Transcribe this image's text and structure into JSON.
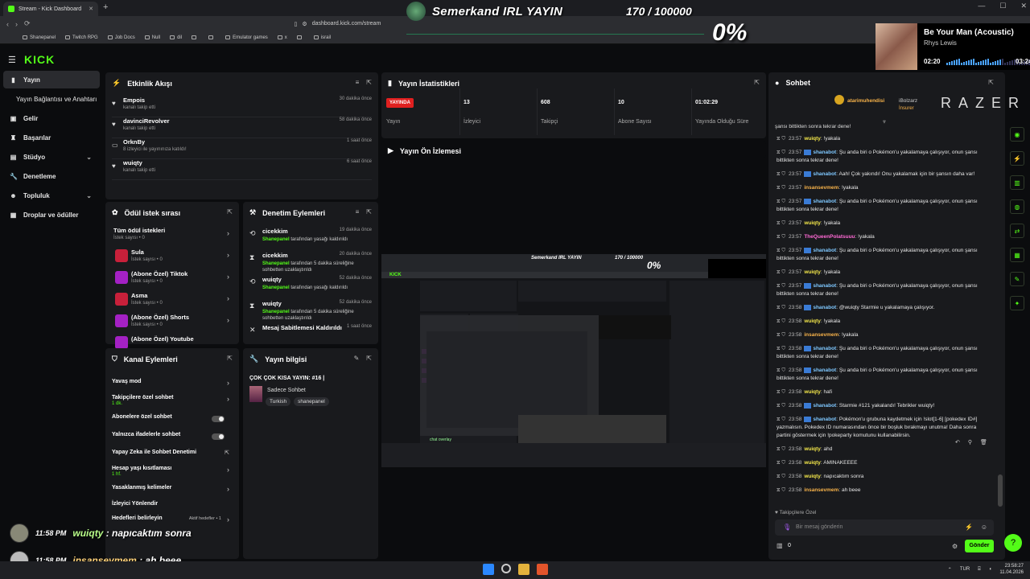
{
  "browser": {
    "tab_title": "Stream - Kick Dashboard",
    "url": "dashboard.kick.com/stream",
    "bookmarks": [
      "Shanepanel",
      "Twitch RPG",
      "Job Docs",
      "Null",
      "dil",
      "",
      "",
      "Emulator games",
      "x",
      "",
      "israil"
    ]
  },
  "overlay": {
    "stream_title": "Semerkand IRL YAYIN",
    "follower_goal": "170 / 100000",
    "percent": "0%",
    "music": {
      "song": "Be Your Man (Acoustic)",
      "artist": "Rhys Lewis",
      "elapsed": "02:20",
      "duration": "03:24"
    }
  },
  "sidebar": {
    "logo": "KICK",
    "items": [
      {
        "label": "Yayın",
        "icon": "broadcast-icon"
      },
      {
        "label": "Yayın Bağlantısı ve Anahtarı",
        "icon": ""
      },
      {
        "label": "Gelir",
        "icon": "revenue-icon"
      },
      {
        "label": "Başarılar",
        "icon": "trophy-icon"
      },
      {
        "label": "Stüdyo",
        "icon": "studio-icon"
      },
      {
        "label": "Denetleme",
        "icon": "wrench-icon"
      },
      {
        "label": "Topluluk",
        "icon": "community-icon"
      },
      {
        "label": "Droplar ve ödüller",
        "icon": "gift-icon"
      }
    ]
  },
  "activity": {
    "title": "Etkinlik Akışı",
    "items": [
      {
        "name": "Empois",
        "desc": "kanalı takip etti",
        "time": "30 dakika önce"
      },
      {
        "name": "davinciRevolver",
        "desc": "kanalı takip etti",
        "time": "58 dakika önce"
      },
      {
        "name": "OrknBy",
        "desc": "8 izleyici ile yayınınıza katıldı!",
        "time": "1 saat önce"
      },
      {
        "name": "wuiqty",
        "desc": "kanalı takip etti",
        "time": "6 saat önce"
      }
    ]
  },
  "stats": {
    "title": "Yayın İstatistikleri",
    "live_badge": "YAYINDA",
    "status_label": "Yayın",
    "viewers": "13",
    "viewers_label": "İzleyici",
    "followers": "608",
    "followers_label": "Takipçi",
    "subs": "10",
    "subs_label": "Abone Sayısı",
    "uptime": "01:02:29",
    "uptime_label": "Yayında Olduğu Süre"
  },
  "preview": {
    "title": "Yayın Ön İzlemesi"
  },
  "rewards": {
    "title": "Ödül istek sırası",
    "items": [
      {
        "name": "Tüm ödül istekleri",
        "sub": "İstek sayısı • 0"
      },
      {
        "name": "Sula",
        "sub": "İstek sayısı • 0"
      },
      {
        "name": "(Abone Özel) Tiktok",
        "sub": "İstek sayısı • 0"
      },
      {
        "name": "Asma",
        "sub": "İstek sayısı • 0"
      },
      {
        "name": "(Abone Özel) Shorts",
        "sub": "İstek sayısı • 0"
      },
      {
        "name": "(Abone Özel) Youtube",
        "sub": ""
      }
    ]
  },
  "moderation": {
    "title": "Denetim Eylemleri",
    "items": [
      {
        "name": "cicekkim",
        "by": "Shanepanel",
        "desc": "tarafından yasağı kaldırıldı",
        "time": "19 dakika önce"
      },
      {
        "name": "cicekkim",
        "by": "Shanepanel",
        "desc": "tarafından 5 dakika süreliğine sohbetten uzaklaştırıldı",
        "time": "20 dakika önce"
      },
      {
        "name": "wuiqty",
        "by": "Shanepanel",
        "desc": "tarafından yasağı kaldırıldı",
        "time": "52 dakika önce"
      },
      {
        "name": "wuiqty",
        "by": "Shanepanel",
        "desc": "tarafından 5 dakika süreliğine sohbetten uzaklaştırıldı",
        "time": "52 dakika önce"
      },
      {
        "name": "Mesaj Sabitlemesi Kaldırıldı",
        "by": "",
        "desc": "",
        "time": "1 saat önce"
      }
    ]
  },
  "channel_actions": {
    "title": "Kanal Eylemleri",
    "items": [
      {
        "label": "Yavaş mod",
        "sub": ""
      },
      {
        "label": "Takipçilere özel sohbet",
        "sub": "1 dk."
      },
      {
        "label": "Abonelere özel sohbet",
        "sub": ""
      },
      {
        "label": "Yalnızca ifadelerle sohbet",
        "sub": ""
      },
      {
        "label": "Yapay Zeka ile Sohbet Denetimi",
        "sub": ""
      },
      {
        "label": "Hesap yaşı kısıtlaması",
        "sub": "1 hf."
      },
      {
        "label": "Yasaklanmış kelimeler",
        "sub": ""
      },
      {
        "label": "İzleyici Yönlendir",
        "sub": ""
      },
      {
        "label": "Hedefleri belirleyin",
        "sub": "Aktif hedefler • 1"
      }
    ]
  },
  "stream_info": {
    "title": "Yayın bilgisi",
    "stream_title": "ÇOK ÇOK KISA YAYIN: #16 |",
    "category": "Sadece Sohbet",
    "tags": [
      "Turkish",
      "shanepanel"
    ]
  },
  "chat": {
    "title": "Sohbet",
    "pinned_user": "atarimuhendisi",
    "pinned_user2": "iBolzarz",
    "pinned_tag": "İnsurer",
    "sponsor": "RAZER",
    "cut_top": "şansı bittikten sonra tekrar dene!",
    "messages": [
      {
        "time": "23:57",
        "user": "wuiqty",
        "cls": "u-w",
        "bot": false,
        "text": "!yakala"
      },
      {
        "time": "23:57",
        "user": "shanabot",
        "cls": "u-s",
        "bot": true,
        "text": "Şu anda biri o Pokémon'u yakalamaya çalışıyor, onun şansı bittikten sonra tekrar dene!"
      },
      {
        "time": "23:57",
        "user": "shanabot",
        "cls": "u-s",
        "bot": true,
        "text": "Aah! Çok yakındı! Onu yakalamak için bir şansın daha var!"
      },
      {
        "time": "23:57",
        "user": "insansevmem",
        "cls": "u-i",
        "bot": false,
        "text": "!yakala"
      },
      {
        "time": "23:57",
        "user": "shanabot",
        "cls": "u-s",
        "bot": true,
        "text": "Şu anda biri o Pokémon'u yakalamaya çalışıyor, onun şansı bittikten sonra tekrar dene!"
      },
      {
        "time": "23:57",
        "user": "wuiqty",
        "cls": "u-w",
        "bot": false,
        "text": "!yakala"
      },
      {
        "time": "23:57",
        "user": "TheQueenPolatsuuu",
        "cls": "u-q",
        "bot": false,
        "text": "!yakala"
      },
      {
        "time": "23:57",
        "user": "shanabot",
        "cls": "u-s",
        "bot": true,
        "text": "Şu anda biri o Pokémon'u yakalamaya çalışıyor, onun şansı bittikten sonra tekrar dene!"
      },
      {
        "time": "23:57",
        "user": "wuiqty",
        "cls": "u-w",
        "bot": false,
        "text": "!yakala"
      },
      {
        "time": "23:57",
        "user": "shanabot",
        "cls": "u-s",
        "bot": true,
        "text": "Şu anda biri o Pokémon'u yakalamaya çalışıyor, onun şansı bittikten sonra tekrar dene!"
      },
      {
        "time": "23:58",
        "user": "shanabot",
        "cls": "u-s",
        "bot": true,
        "text": "@wuiqty Starmie u yakalamaya çalışıyor."
      },
      {
        "time": "23:58",
        "user": "wuiqty",
        "cls": "u-w",
        "bot": false,
        "text": "!yakala"
      },
      {
        "time": "23:58",
        "user": "insansevmem",
        "cls": "u-i",
        "bot": false,
        "text": "!yakala"
      },
      {
        "time": "23:58",
        "user": "shanabot",
        "cls": "u-s",
        "bot": true,
        "text": "Şu anda biri o Pokémon'u yakalamaya çalışıyor, onun şansı bittikten sonra tekrar dene!"
      },
      {
        "time": "23:58",
        "user": "shanabot",
        "cls": "u-s",
        "bot": true,
        "text": "Şu anda biri o Pokémon'u yakalamaya çalışıyor, onun şansı bittikten sonra tekrar dene!"
      },
      {
        "time": "23:58",
        "user": "wuiqty",
        "cls": "u-w",
        "bot": false,
        "text": "hafi"
      },
      {
        "time": "23:58",
        "user": "shanabot",
        "cls": "u-s",
        "bot": true,
        "text": "Starmie #121 yakalandı! Tebrikler wuiqty!"
      },
      {
        "time": "23:58",
        "user": "shanabot",
        "cls": "u-s",
        "bot": true,
        "text": "Pokémon'u grubuna kaydetmek için !slot[1-6] [pokedex ID#] yazmalısın. Pokedex ID numarasından önce bir boşluk bırakmayı unutma! Daha sonra partini göstermek için !pokeparty komutunu kullanabilirsin."
      },
      {
        "time": "23:58",
        "user": "wuiqty",
        "cls": "u-w",
        "bot": false,
        "text": "ahd"
      },
      {
        "time": "23:58",
        "user": "wuiqty",
        "cls": "u-w",
        "bot": false,
        "text": "AMINAKEEEE"
      },
      {
        "time": "23:58",
        "user": "wuiqty",
        "cls": "u-w",
        "bot": false,
        "text": "napıcaktım sonra"
      },
      {
        "time": "23:58",
        "user": "insansevmem",
        "cls": "u-i",
        "bot": false,
        "text": "ah beee"
      }
    ],
    "followers_only": "Takipçilere Özel",
    "input_placeholder": "Bir mesaj gönderin",
    "points": "0",
    "send_label": "Gönder"
  },
  "overlay_chat": [
    {
      "time": "11:58 PM",
      "user": "wuiqty",
      "msg": "napıcaktım sonra"
    },
    {
      "time": "11:58 PM",
      "user": "insansevmem",
      "msg": "ah beee"
    }
  ],
  "taskbar": {
    "lang": "TUR",
    "time": "23:58:27",
    "date": "11.04.2026"
  }
}
